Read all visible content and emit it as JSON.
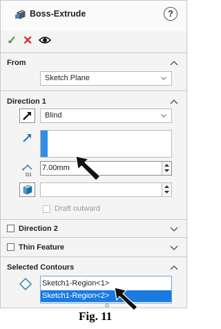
{
  "header": {
    "title": "Boss-Extrude",
    "help_label": "?"
  },
  "actions": {
    "ok_glyph": "✓",
    "cancel_glyph": "✕"
  },
  "from": {
    "title": "From",
    "start_condition": "Sketch Plane"
  },
  "direction1": {
    "title": "Direction 1",
    "end_condition": "Blind",
    "depth_value": "7.00mm",
    "depth_icon_label": "D1",
    "draft_outward_label": "Draft outward"
  },
  "direction2": {
    "title": "Direction 2"
  },
  "thin_feature": {
    "title": "Thin Feature"
  },
  "selected_contours": {
    "title": "Selected Contours",
    "items": [
      {
        "label": "Sketch1-Region<1>",
        "selected": false
      },
      {
        "label": "Sketch1-Region<2>",
        "selected": true
      }
    ]
  },
  "caption": {
    "text": "Fig. 11"
  },
  "colors": {
    "accent_blue": "#1a7ae0",
    "ok_green": "#3aa63a",
    "cancel_red": "#d7262b"
  }
}
